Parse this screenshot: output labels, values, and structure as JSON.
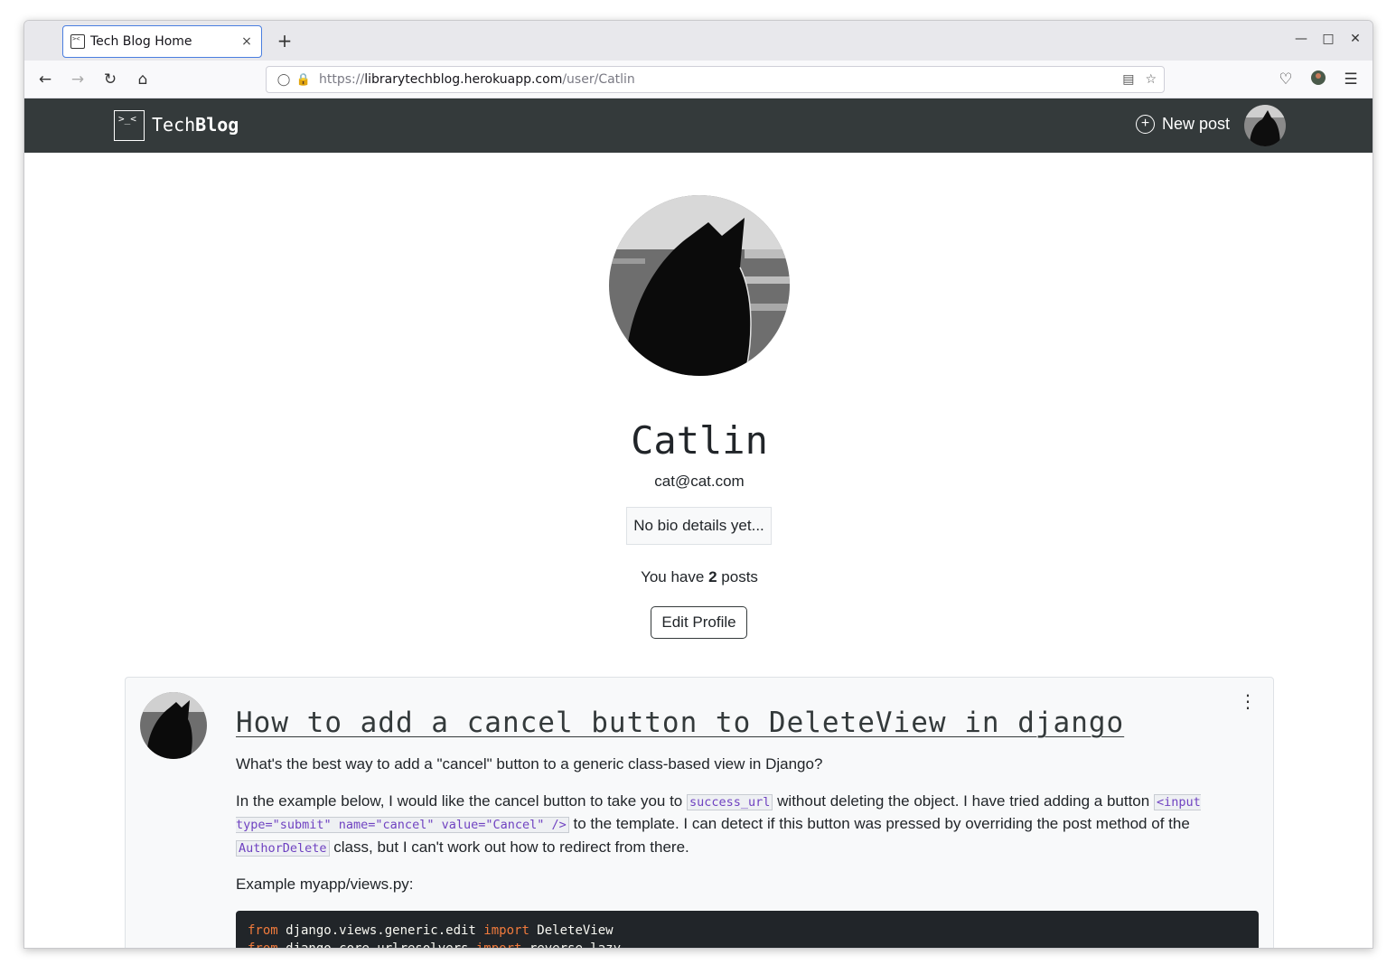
{
  "browser": {
    "tab_title": "Tech Blog Home",
    "tab_close": "×",
    "new_tab": "+",
    "url_prefix": "https://",
    "url_host": "librarytechblog.herokuapp.com",
    "url_path": "/user/Catlin"
  },
  "site": {
    "logo_glyph": ">_<",
    "logo_light": "Tech",
    "logo_bold": "Blog",
    "new_post_label": "New post"
  },
  "profile": {
    "username": "Catlin",
    "email": "cat@cat.com",
    "bio": "No bio details yet...",
    "posts_prefix": "You have",
    "posts_count": "2",
    "posts_suffix": "posts",
    "edit_label": "Edit Profile"
  },
  "post": {
    "title": "How to add a cancel button to DeleteView in django",
    "para1": "What's the best way to add a \"cancel\" button to a generic class-based view in Django?",
    "para2_a": "In the example below, I would like the cancel button to take you to",
    "code_success_url": "success_url",
    "para2_b": "without deleting the object. I have tried adding a button",
    "code_input": "<input type=\"submit\" name=\"cancel\" value=\"Cancel\" />",
    "para2_c": "to the template. I can detect if this button was pressed by overriding the post method of the",
    "code_class": "AuthorDelete",
    "para2_d": "class, but I can't work out how to redirect from there.",
    "para3": "Example myapp/views.py:",
    "code_lines": [
      {
        "kw1": "from",
        "mod": " django.views.generic.edit ",
        "kw2": "import",
        "name": " DeleteView"
      },
      {
        "kw1": "from",
        "mod": " django.core.urlresolvers ",
        "kw2": "import",
        "name": " reverse_lazy"
      }
    ]
  },
  "colors": {
    "header_bg": "#343a3b",
    "card_bg": "#f8f9fa",
    "code_bg": "#212529",
    "inline_code": "#6f42c1",
    "keyword": "#f07a3c"
  }
}
